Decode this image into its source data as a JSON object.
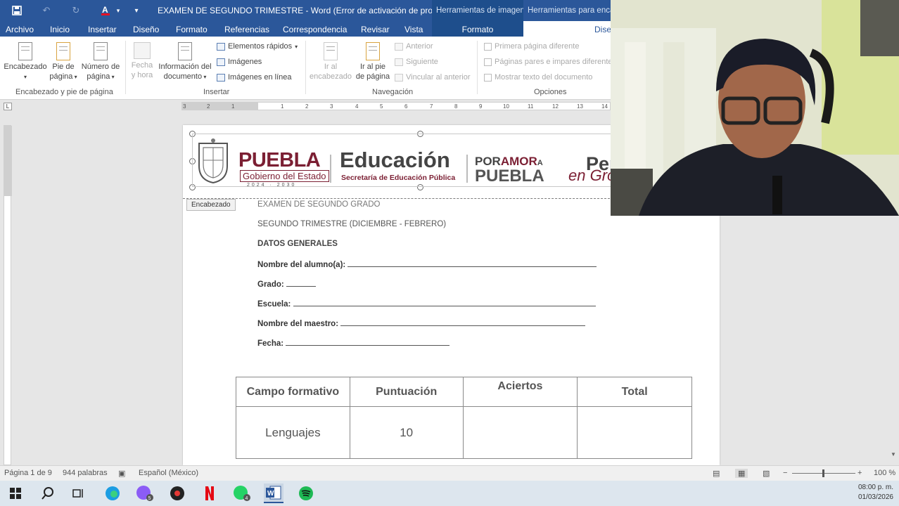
{
  "window": {
    "title": "EXAMEN DE SEGUNDO TRIMESTRE - Word (Error de activación de product...",
    "contextual_image_tools": "Herramientas de imagen",
    "contextual_header_tools": "Herramientas para encab"
  },
  "tabs": [
    "Archivo",
    "Inicio",
    "Insertar",
    "Diseño",
    "Formato",
    "Referencias",
    "Correspondencia",
    "Revisar",
    "Vista"
  ],
  "contextual_tabs": {
    "formato": "Formato",
    "diseno": "Dise"
  },
  "ribbon": {
    "group1": {
      "encabezado": "Encabezado",
      "pie_a": "Pie de",
      "pie_b": "página",
      "numero_a": "Número de",
      "numero_b": "página",
      "label": "Encabezado y pie de página"
    },
    "group2": {
      "fecha_a": "Fecha",
      "fecha_b": "y hora",
      "info_a": "Información del",
      "info_b": "documento",
      "elementos": "Elementos rápidos",
      "imagenes": "Imágenes",
      "imagenes_linea": "Imágenes en línea",
      "label": "Insertar"
    },
    "group3": {
      "ir_enc_a": "Ir al",
      "ir_enc_b": "encabezado",
      "ir_pie_a": "Ir al pie",
      "ir_pie_b": "de página",
      "anterior": "Anterior",
      "siguiente": "Siguiente",
      "vincular": "Vincular al anterior",
      "label": "Navegación"
    },
    "group4": {
      "primera": "Primera página diferente",
      "pares": "Páginas pares e impares diferentes",
      "mostrar": "Mostrar texto del documento",
      "label": "Opciones"
    }
  },
  "ruler": {
    "marks": [
      "3",
      "2",
      "1",
      "1",
      "2",
      "3",
      "4",
      "5",
      "6",
      "7",
      "8",
      "9",
      "10",
      "11",
      "12",
      "13",
      "14"
    ]
  },
  "document": {
    "header_tag": "Encabezado",
    "logo": {
      "puebla": "PUEBLA",
      "gobierno": "Gobierno del Estado",
      "years": "2024 · 2030",
      "educacion": "Educación",
      "secretaria": "Secretaría de Educación Pública",
      "por": "POR",
      "amor": "AMOR",
      "a": "A",
      "puebla2": "PUEBLA",
      "pen": "Pen",
      "gro": "en Gro"
    },
    "lines": {
      "exam": "EXAMEN DE SEGUNDO GRADO",
      "trimestre": "SEGUNDO TRIMESTRE (DICIEMBRE - FEBRERO)",
      "datos": "DATOS GENERALES",
      "alumno": "Nombre del alumno(a):",
      "grado": "Grado:",
      "escuela": "Escuela:",
      "maestro": "Nombre del maestro:",
      "fecha": "Fecha:"
    },
    "table": {
      "headers": [
        "Campo formativo",
        "Puntuación",
        "Aciertos",
        "Total"
      ],
      "rows": [
        [
          "Lenguajes",
          "10",
          "",
          ""
        ]
      ]
    }
  },
  "status": {
    "page": "Página 1 de 9",
    "words": "944 palabras",
    "language": "Español (México)",
    "zoom": "100 %"
  },
  "taskbar": {
    "time": "08:00 p. m.",
    "date": "01/03/2026",
    "badges": {
      "app_a": "5",
      "whatsapp": "4"
    }
  }
}
